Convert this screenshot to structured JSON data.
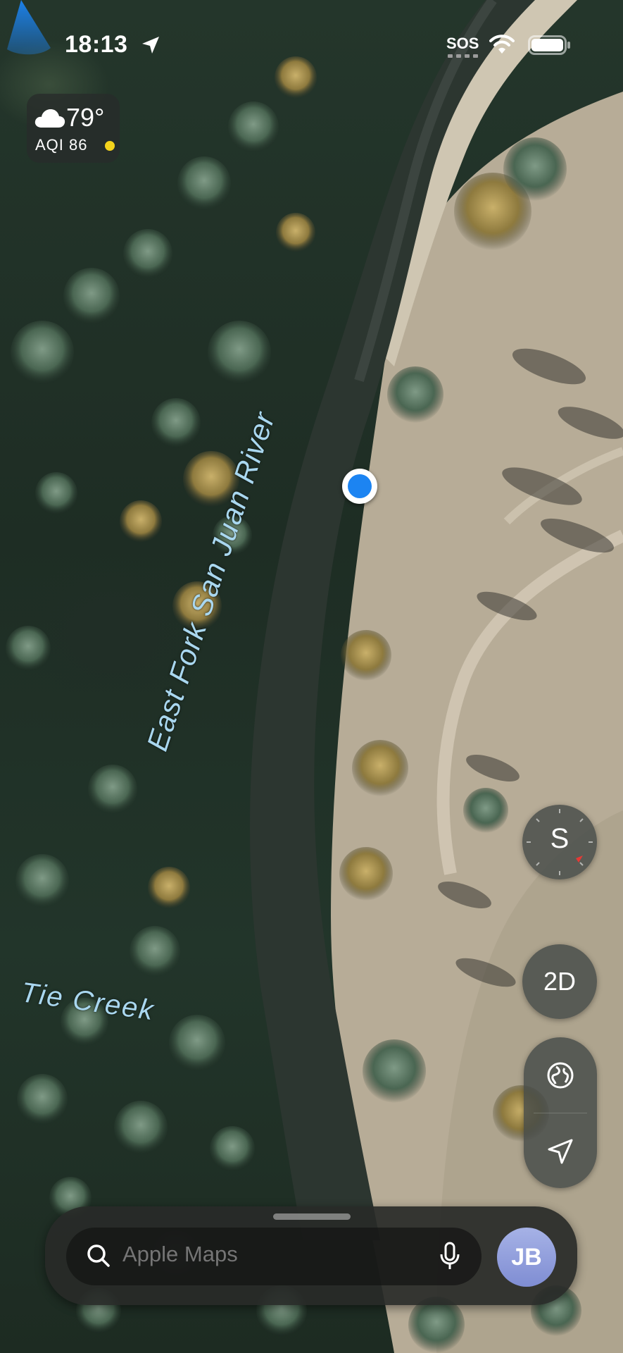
{
  "status_bar": {
    "time": "18:13",
    "sos": "SOS",
    "icons": [
      "location-arrow-icon",
      "wifi-icon",
      "battery-icon"
    ]
  },
  "weather": {
    "icon": "cloud-icon",
    "temperature": "79°",
    "aqi": "AQI 86",
    "aqi_color": "#f4d31c"
  },
  "map": {
    "labels": {
      "river": "East Fork San Juan River",
      "creek": "Tie Creek"
    },
    "label_color": "#a9d7ef",
    "user_location_color": "#1c84f2"
  },
  "controls": {
    "compass_heading": "S",
    "mode_toggle": "2D",
    "globe_icon": "globe-icon",
    "locate_icon": "location-arrow-icon"
  },
  "search": {
    "placeholder": "Apple Maps",
    "avatar_initials": "JB",
    "icons": [
      "search-icon",
      "microphone-icon"
    ]
  }
}
